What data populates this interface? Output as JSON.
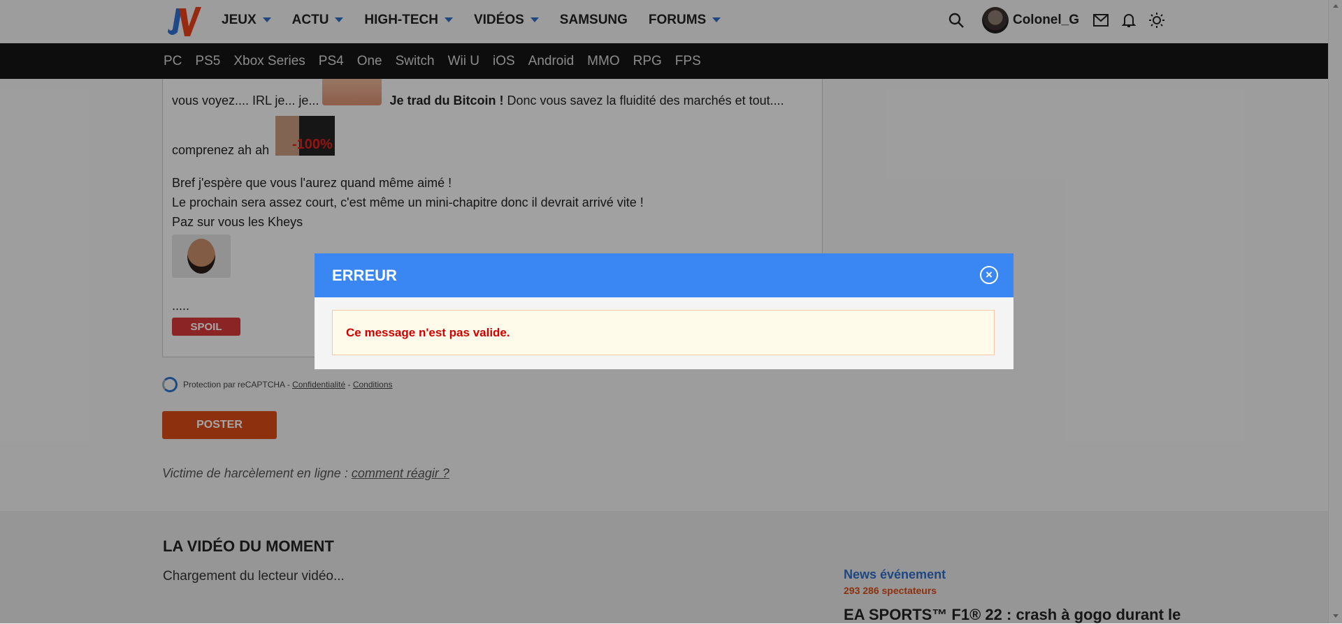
{
  "header": {
    "logo_text": "JV",
    "nav": [
      {
        "label": "JEUX",
        "dropdown": true
      },
      {
        "label": "ACTU",
        "dropdown": true
      },
      {
        "label": "HIGH-TECH",
        "dropdown": true
      },
      {
        "label": "VIDÉOS",
        "dropdown": true
      },
      {
        "label": "SAMSUNG",
        "dropdown": false
      },
      {
        "label": "FORUMS",
        "dropdown": true
      }
    ],
    "username": "Colonel_G",
    "icons": [
      "search-icon",
      "avatar",
      "mail-icon",
      "bell-icon",
      "theme-sun-icon"
    ]
  },
  "platforms": [
    "PC",
    "PS5",
    "Xbox Series",
    "PS4",
    "One",
    "Switch",
    "Wii U",
    "iOS",
    "Android",
    "MMO",
    "RPG",
    "FPS"
  ],
  "post": {
    "line1_before": "vous voyez.... IRL je... je...",
    "line1_bold": "Je trad du Bitcoin !",
    "line1_after": "Donc vous savez la fluidité des marchés et tout....",
    "line2": "comprenez ah ah",
    "sticker_text": "-100%",
    "line3": "Bref j'espère que vous l'aurez quand même aimé !",
    "line4": "Le prochain sera assez court, c'est même un mini-chapitre donc il devrait arrivé vite !",
    "line5": "Paz sur vous les Kheys",
    "dots": ".....",
    "spoil_label": "SPOIL"
  },
  "captcha": {
    "text": "Protection par reCAPTCHA -",
    "privacy": "Confidentialité",
    "sep": "-",
    "terms": "Conditions"
  },
  "poster_label": "POSTER",
  "harass": {
    "text": "Victime de harcèlement en ligne :",
    "link": "comment réagir ?"
  },
  "video": {
    "title": "LA VIDÉO DU MOMENT",
    "loading": "Chargement du lecteur vidéo...",
    "news_label": "News événement",
    "spectators": "293 286 spectateurs",
    "headline": "EA SPORTS™ F1® 22 : crash à gogo durant le"
  },
  "modal": {
    "title": "ERREUR",
    "message": "Ce message n'est pas valide.",
    "close_glyph": "×"
  },
  "colors": {
    "accent_blue": "#3a87f4",
    "poster_orange": "#d84b16",
    "spoil_red": "#d63a3a",
    "error_red": "#d20000"
  }
}
